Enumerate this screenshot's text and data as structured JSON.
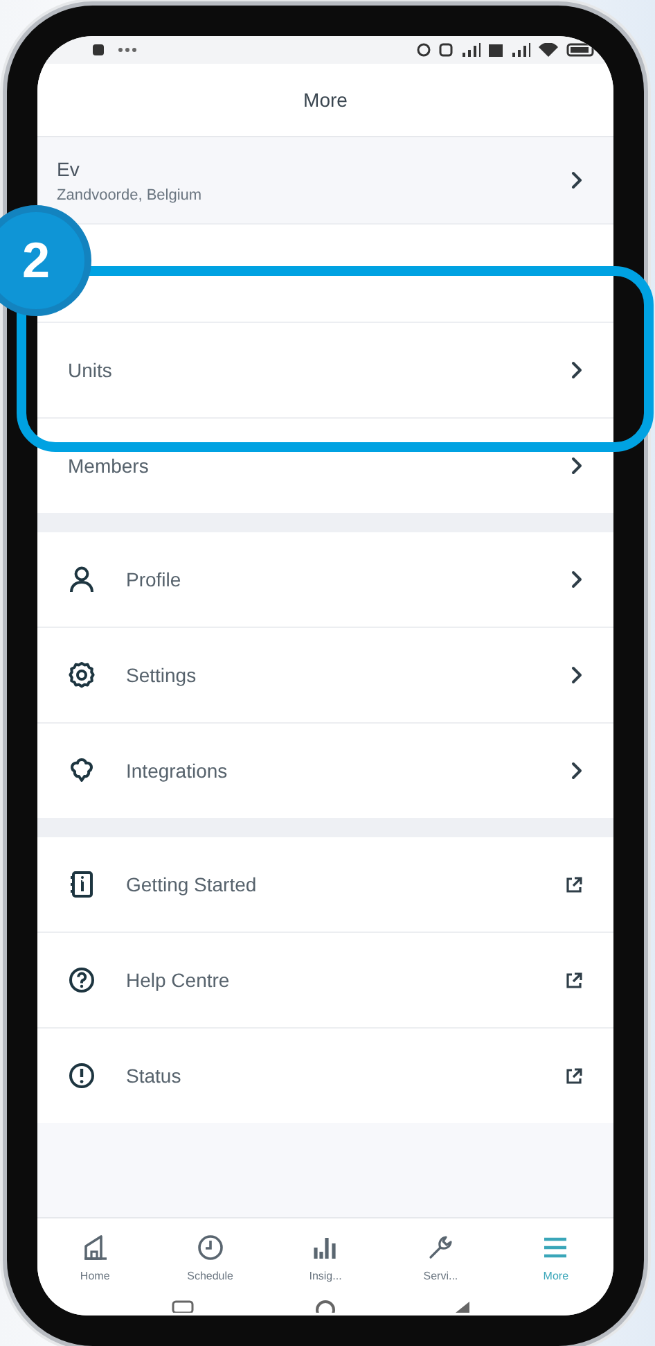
{
  "screen_title": "More",
  "location": {
    "name": "Ev",
    "address": "Zandvoorde, Belgium"
  },
  "sections": [
    {
      "items": [
        {
          "label": "Units",
          "kind": "nav"
        },
        {
          "label": "Members",
          "kind": "nav"
        }
      ]
    },
    {
      "items": [
        {
          "label": "Profile",
          "kind": "nav"
        },
        {
          "label": "Settings",
          "kind": "nav"
        },
        {
          "label": "Integrations",
          "kind": "nav"
        }
      ]
    },
    {
      "items": [
        {
          "label": "Getting Started",
          "kind": "external"
        },
        {
          "label": "Help Centre",
          "kind": "external"
        },
        {
          "label": "Status",
          "kind": "external"
        }
      ]
    }
  ],
  "tab_bar": [
    {
      "label": "Home",
      "selected": false
    },
    {
      "label": "Schedule",
      "selected": false
    },
    {
      "label": "Insig...",
      "selected": false
    },
    {
      "label": "Servi...",
      "selected": false
    },
    {
      "label": "More",
      "selected": true
    }
  ],
  "callout": {
    "step": "2"
  }
}
